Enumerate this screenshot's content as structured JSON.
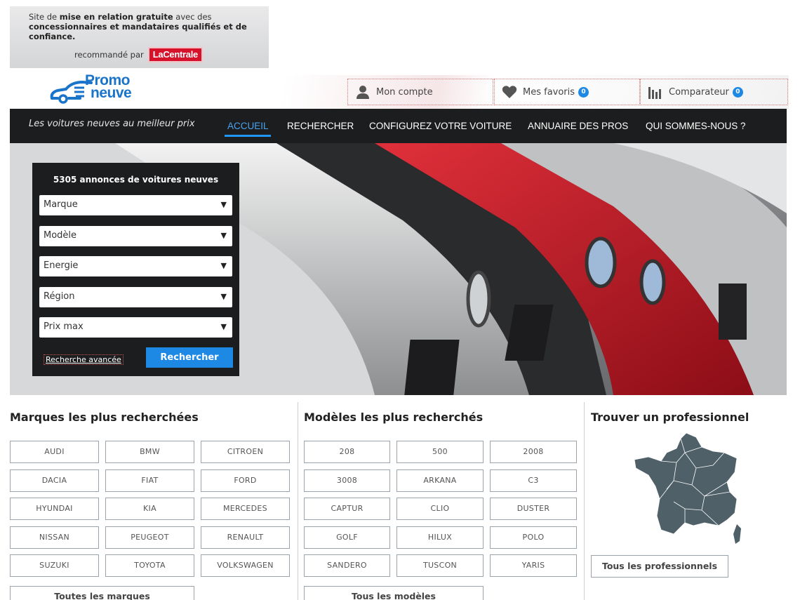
{
  "banner": {
    "text_1": "Site de ",
    "text_bold_1": "mise en relation gratuite",
    "text_2": " avec des ",
    "text_bold_2": "concessionnaires et mandataires qualifiés et de confiance.",
    "recommended": "recommandé par",
    "lacentrale_logo": "LaCentrale"
  },
  "header": {
    "logo_line1": "Promo",
    "logo_line2": "neuve",
    "account": "Mon compte",
    "favorites": "Mes favoris",
    "favorites_count": "0",
    "compare": "Comparateur",
    "compare_count": "0"
  },
  "nav": {
    "tagline": "Les voitures neuves au meilleur prix",
    "items": [
      "ACCUEIL",
      "RECHERCHER",
      "CONFIGUREZ VOTRE VOITURE",
      "ANNUAIRE DES PROS",
      "QUI SOMMES-NOUS ?"
    ],
    "active": "ACCUEIL"
  },
  "search": {
    "title": "5305 annonces de voitures neuves",
    "selects": [
      "Marque",
      "Modèle",
      "Energie",
      "Région",
      "Prix max"
    ],
    "advanced_link": "Recherche avancée",
    "submit": "Rechercher"
  },
  "brands": {
    "title": "Marques les plus recherchées",
    "items": [
      "AUDI",
      "BMW",
      "CITROEN",
      "DACIA",
      "FIAT",
      "FORD",
      "HYUNDAI",
      "KIA",
      "MERCEDES",
      "NISSAN",
      "PEUGEOT",
      "RENAULT",
      "SUZUKI",
      "TOYOTA",
      "VOLKSWAGEN"
    ],
    "all": "Toutes les marques"
  },
  "models": {
    "title": "Modèles les plus recherchés",
    "items": [
      "208",
      "500",
      "2008",
      "3008",
      "ARKANA",
      "C3",
      "CAPTUR",
      "CLIO",
      "DUSTER",
      "GOLF",
      "HILUX",
      "POLO",
      "SANDERO",
      "TUSCON",
      "YARIS"
    ],
    "all": "Tous les modèles"
  },
  "pros": {
    "title": "Trouver un professionnel",
    "all": "Tous les professionnels"
  },
  "colors": {
    "nav_bg": "#1c1d1e",
    "accent": "#1e88e5",
    "map": "#4f6068"
  }
}
